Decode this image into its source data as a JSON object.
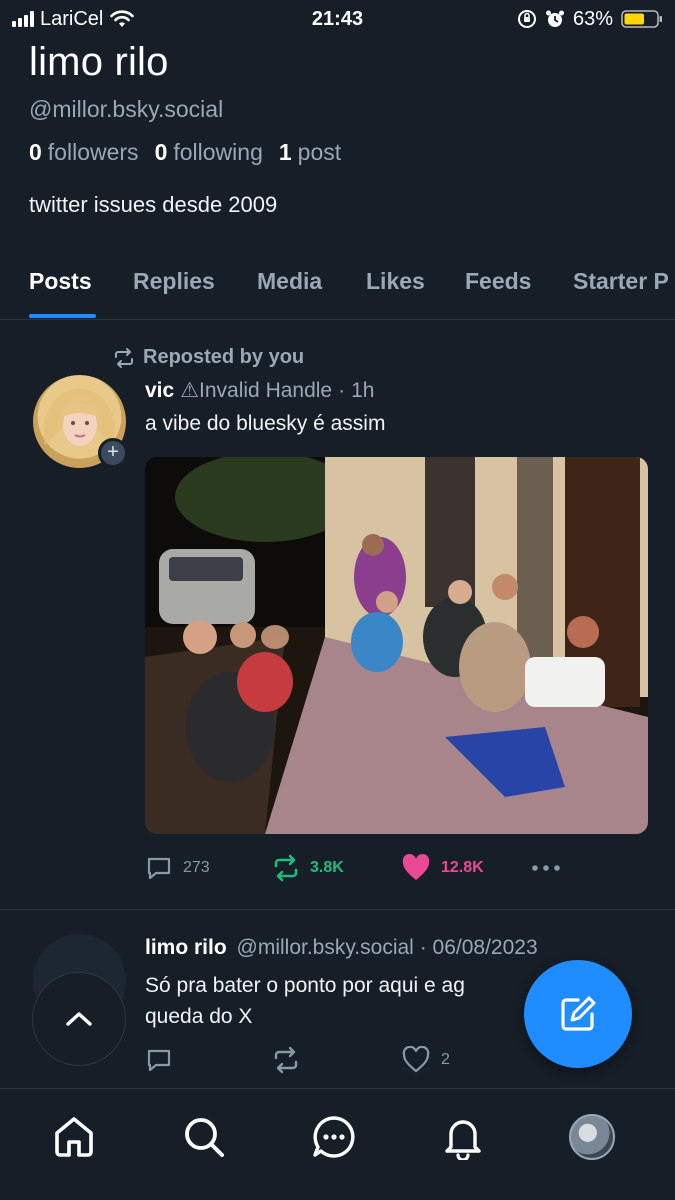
{
  "status_bar": {
    "carrier": "LariCel",
    "time": "21:43",
    "battery_percent": "63%",
    "battery_level": 0.63
  },
  "profile": {
    "name": "limo rilo",
    "handle": "@millor.bsky.social",
    "followers_count": "0",
    "followers_label": "followers",
    "following_count": "0",
    "following_label": "following",
    "posts_count": "1",
    "posts_label": "post",
    "bio": "twitter issues desde 2009"
  },
  "tabs": [
    {
      "label": "Posts",
      "active": true
    },
    {
      "label": "Replies"
    },
    {
      "label": "Media"
    },
    {
      "label": "Likes"
    },
    {
      "label": "Feeds"
    },
    {
      "label": "Starter P"
    }
  ],
  "posts": [
    {
      "repost_label": "Reposted by you",
      "author_name": "vic",
      "author_handle": "⚠Invalid Handle",
      "separator": "·",
      "time": "1h",
      "text": "a vibe do bluesky é assim",
      "replies": "273",
      "reposts": "3.8K",
      "likes": "12.8K"
    },
    {
      "author_name": "limo rilo",
      "author_handle": "@millor.bsky.social",
      "separator": "·",
      "time": "06/08/2023",
      "text": "Só pra bater o ponto por aqui e ag",
      "text_suffix": "a",
      "text_line2": "queda do X",
      "likes": "2"
    }
  ],
  "colors": {
    "background": "#161e27",
    "accent": "#1f8cff",
    "repost_green": "#20bc7b",
    "like_pink": "#ec4899",
    "muted": "#9aa7b5"
  },
  "icons": {
    "nav": [
      "home-icon",
      "search-icon",
      "chat-icon",
      "bell-icon",
      "profile-avatar"
    ],
    "fab": "compose-icon",
    "scroll": "chevron-up-icon"
  }
}
